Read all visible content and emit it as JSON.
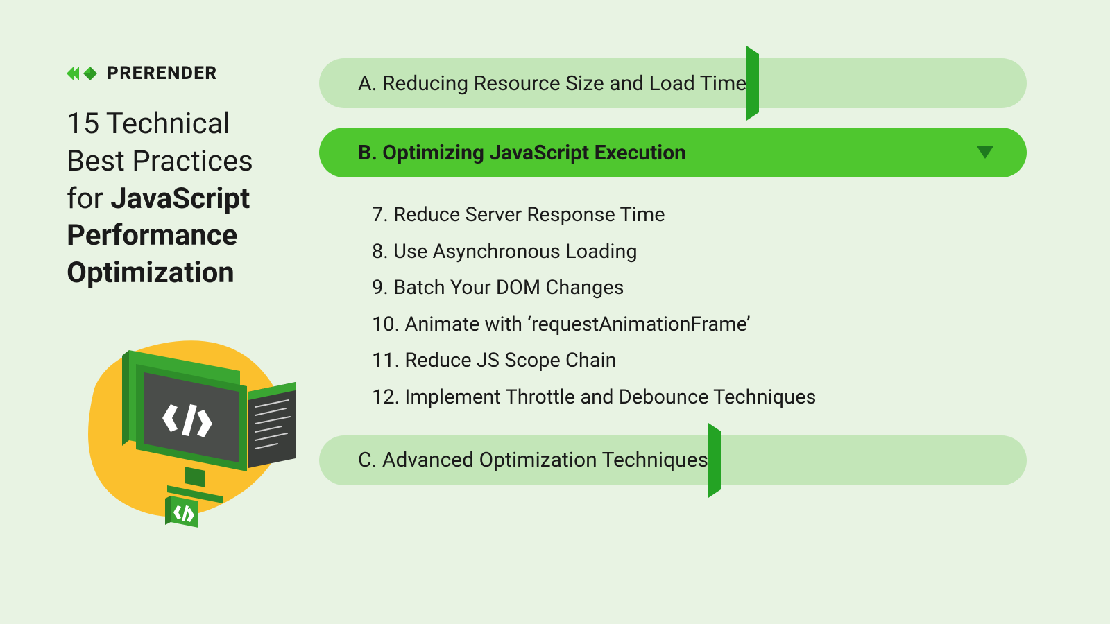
{
  "brand": {
    "name": "PRERENDER"
  },
  "headline": {
    "line1": "15 Technical",
    "line2": "Best Practices",
    "line3": "for",
    "boldA": "JavaScript",
    "boldB": "Performance",
    "boldC": "Optimization"
  },
  "sections": {
    "a": {
      "label": "A. Reducing Resource Size and Load Time"
    },
    "b": {
      "label": "B. Optimizing JavaScript Execution",
      "items": [
        "7. Reduce Server Response Time",
        "8. Use Asynchronous Loading",
        "9. Batch Your DOM Changes",
        "10. Animate with ‘requestAnimationFrame’",
        "11. Reduce JS Scope Chain",
        "12. Implement Throttle and Debounce Techniques"
      ]
    },
    "c": {
      "label": "C. Advanced Optimization Techniques"
    }
  }
}
